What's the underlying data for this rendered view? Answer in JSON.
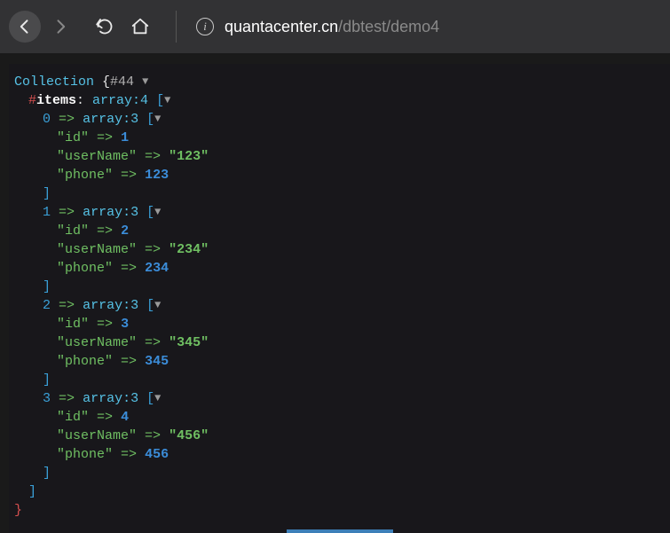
{
  "toolbar": {
    "back_icon": "arrow-left",
    "forward_icon": "arrow-right",
    "reload_icon": "reload",
    "home_icon": "home",
    "info_icon": "i",
    "url_host": "quantacenter.cn",
    "url_path": "/dbtest/demo4"
  },
  "dump": {
    "class_label": "Collection",
    "object_id": "#44",
    "items_key_prefix": "#",
    "items_key_word": "items",
    "array_label": "array",
    "items_count": "4",
    "arrow": "=>",
    "triangle": "▼",
    "open_brace": "{",
    "close_brace": "}",
    "open_bracket": "[",
    "close_bracket": "]",
    "records": [
      {
        "index": "0",
        "array_count": "3",
        "fields": {
          "id": {
            "key": "\"id\"",
            "value": "1",
            "is_string": false
          },
          "userName": {
            "key": "\"userName\"",
            "value": "\"123\"",
            "is_string": true
          },
          "phone": {
            "key": "\"phone\"",
            "value": "123",
            "is_string": false
          }
        }
      },
      {
        "index": "1",
        "array_count": "3",
        "fields": {
          "id": {
            "key": "\"id\"",
            "value": "2",
            "is_string": false
          },
          "userName": {
            "key": "\"userName\"",
            "value": "\"234\"",
            "is_string": true
          },
          "phone": {
            "key": "\"phone\"",
            "value": "234",
            "is_string": false
          }
        }
      },
      {
        "index": "2",
        "array_count": "3",
        "fields": {
          "id": {
            "key": "\"id\"",
            "value": "3",
            "is_string": false
          },
          "userName": {
            "key": "\"userName\"",
            "value": "\"345\"",
            "is_string": true
          },
          "phone": {
            "key": "\"phone\"",
            "value": "345",
            "is_string": false
          }
        }
      },
      {
        "index": "3",
        "array_count": "3",
        "fields": {
          "id": {
            "key": "\"id\"",
            "value": "4",
            "is_string": false
          },
          "userName": {
            "key": "\"userName\"",
            "value": "\"456\"",
            "is_string": true
          },
          "phone": {
            "key": "\"phone\"",
            "value": "456",
            "is_string": false
          }
        }
      }
    ]
  }
}
